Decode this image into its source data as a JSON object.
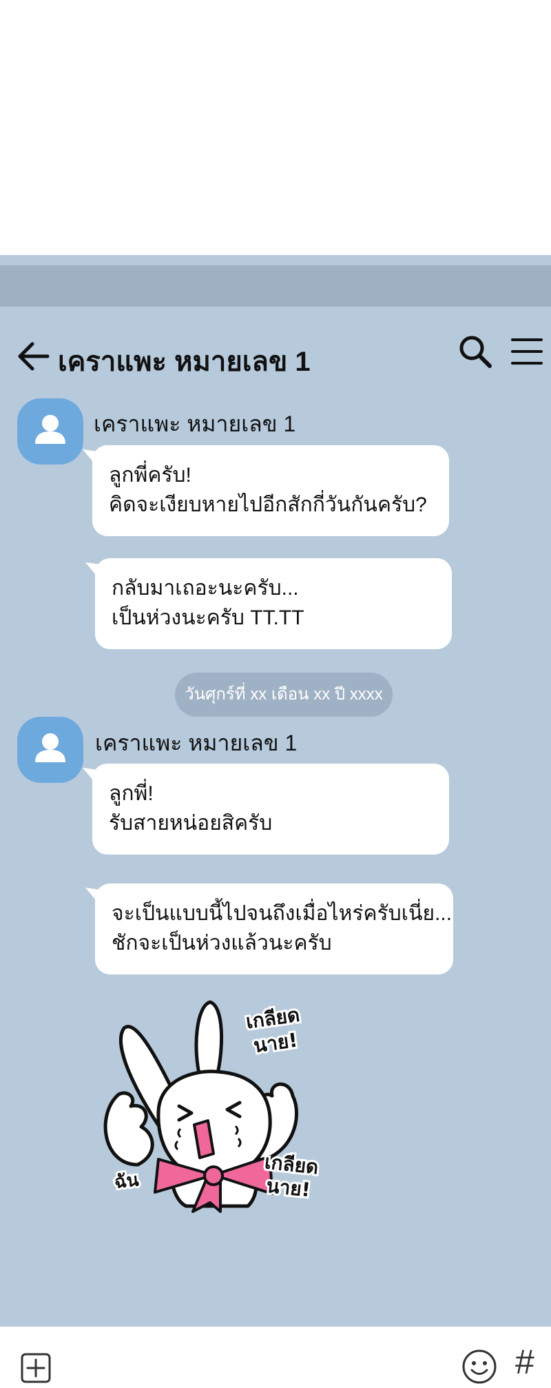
{
  "header": {
    "back_icon": "arrow-left-icon",
    "title": "เคราแพะ หมายเลข 1",
    "search_icon": "search-icon",
    "menu_icon": "hamburger-menu-icon"
  },
  "messages": [
    {
      "sender": "เคราแพะ หมายเลข 1",
      "bubbles": [
        {
          "lines": [
            "ลูกพี่ครับ!",
            "คิดจะเงียบหายไปอีกสักกี่วันกันครับ?"
          ]
        },
        {
          "lines": [
            "กลับมาเถอะนะครับ...",
            "เป็นห่วงนะครับ TT.TT"
          ]
        }
      ]
    },
    {
      "sender": "เคราแพะ หมายเลข 1",
      "bubbles": [
        {
          "lines": [
            "ลูกพี่!",
            "รับสายหน่อยสิครับ"
          ]
        },
        {
          "lines": [
            "จะเป็นแบบนี้ไปจนถึงเมื่อไหร่ครับเนี่ย...",
            "ชักจะเป็นห่วงแล้วนะครับ"
          ]
        }
      ]
    }
  ],
  "date_separator": "วันศุกร์ที่ xx เดือน xx ปี xxxx",
  "sticker": {
    "icon": "crying-rabbit-sticker",
    "text_top": [
      "เกลียด",
      "นาย!"
    ],
    "text_bottom": [
      "เกลียด",
      "นาย!"
    ],
    "text_left": "ฉัน"
  },
  "input_bar": {
    "plus_icon": "plus-box-icon",
    "emoji_icon": "smiley-icon",
    "hashtag_label": "#"
  },
  "colors": {
    "chat_background": "#b7cadc",
    "status_strip": "#9eb0c2",
    "avatar": "#6ea9dd",
    "bubble": "#ffffff",
    "date_pill": "#9fb1c4",
    "bow": "#f0679a"
  }
}
